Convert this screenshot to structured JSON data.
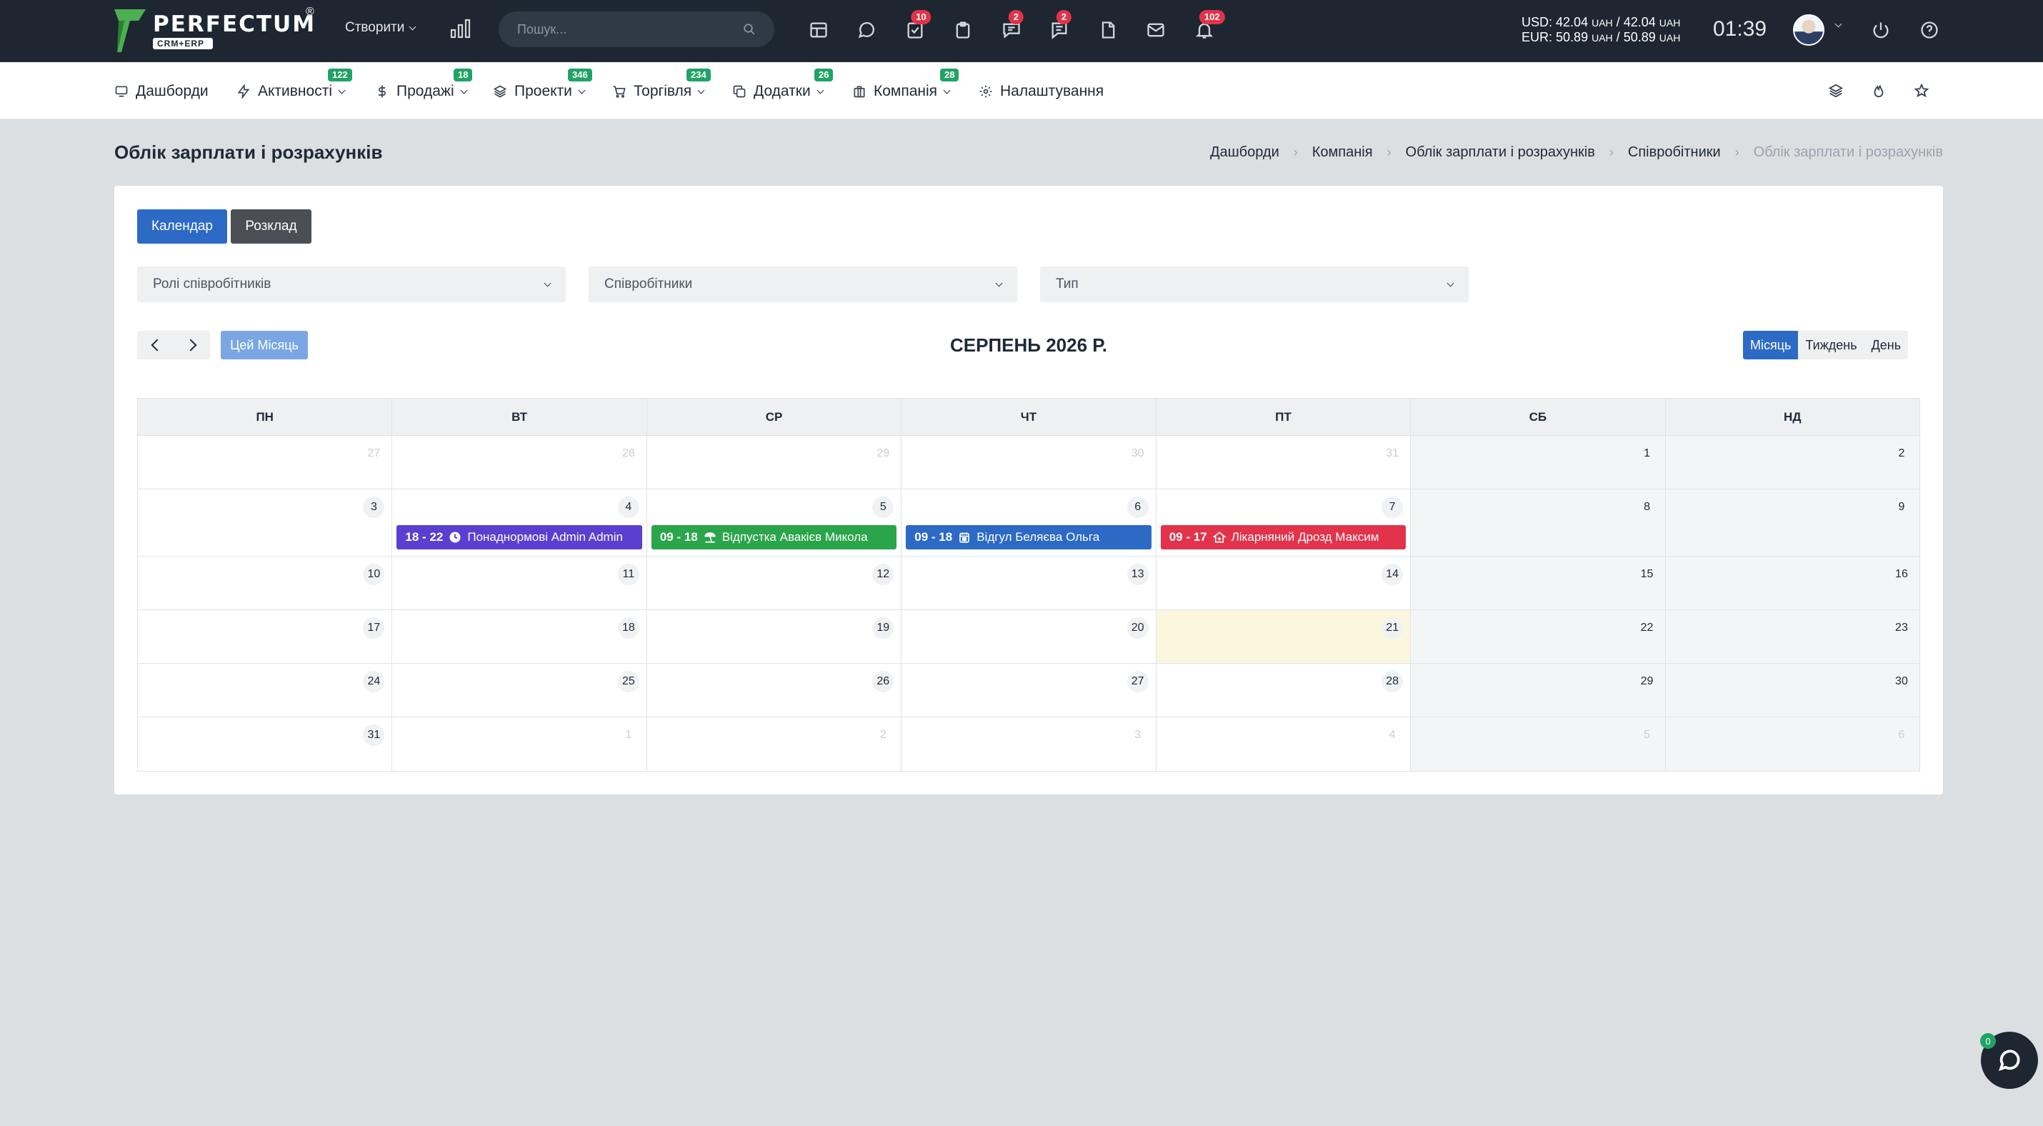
{
  "brand": {
    "name": "PERFECTUM",
    "sub": "CRM+ERP",
    "reg": "®"
  },
  "topbar": {
    "create_label": "Створити",
    "search_placeholder": "Пошук...",
    "icons": [
      {
        "name": "table-icon"
      },
      {
        "name": "chat-icon"
      },
      {
        "name": "tasks-icon",
        "badge": "10"
      },
      {
        "name": "clipboard-icon"
      },
      {
        "name": "messages-icon",
        "badge": "2"
      },
      {
        "name": "comments-icon",
        "badge": "2"
      },
      {
        "name": "document-icon"
      },
      {
        "name": "mail-icon"
      },
      {
        "name": "bell-icon",
        "badge": "102"
      }
    ],
    "rates": {
      "usd_label": "USD:",
      "usd_value": "42.04",
      "usd_cur1": "UAH",
      "usd_sep": "/",
      "usd_value2": "42.04",
      "usd_cur2": "UAH",
      "eur_label": "EUR:",
      "eur_value": "50.89",
      "eur_cur1": "UAH",
      "eur_sep": "/",
      "eur_value2": "50.89",
      "eur_cur2": "UAH"
    },
    "time": "01:39"
  },
  "nav": {
    "items": [
      {
        "label": "Дашборди",
        "icon": "monitor-icon"
      },
      {
        "label": "Активності",
        "badge": "122",
        "icon": "bolt-icon"
      },
      {
        "label": "Продажі",
        "badge": "18",
        "icon": "dollar-icon"
      },
      {
        "label": "Проекти",
        "badge": "346",
        "icon": "layers-icon"
      },
      {
        "label": "Торгівля",
        "badge": "234",
        "icon": "cart-icon"
      },
      {
        "label": "Додатки",
        "badge": "26",
        "icon": "copy-icon"
      },
      {
        "label": "Компанія",
        "badge": "28",
        "icon": "building-icon"
      },
      {
        "label": "Налаштування",
        "icon": "gear-icon"
      }
    ]
  },
  "page": {
    "title": "Облік зарплати і розрахунків",
    "breadcrumb": [
      "Дашборди",
      "Компанія",
      "Облік зарплати і розрахунків",
      "Співробітники",
      "Облік зарплати і розрахунків"
    ]
  },
  "toolbar": {
    "calendar_label": "Календар",
    "schedule_label": "Розклад",
    "filters": [
      "Ролі співробітників",
      "Співробітники",
      "Тип"
    ],
    "today_label": "Цей Місяць",
    "month_title": "СЕРПЕНЬ 2026 Р.",
    "views": [
      "Місяць",
      "Тиждень",
      "День"
    ],
    "active_view": "Місяць"
  },
  "calendar": {
    "weekdays": [
      "ПН",
      "ВТ",
      "СР",
      "ЧТ",
      "ПТ",
      "СБ",
      "НД"
    ],
    "weeks": [
      [
        "27",
        "28",
        "29",
        "30",
        "31",
        "1",
        "2"
      ],
      [
        "3",
        "4",
        "5",
        "6",
        "7",
        "8",
        "9"
      ],
      [
        "10",
        "11",
        "12",
        "13",
        "14",
        "15",
        "16"
      ],
      [
        "17",
        "18",
        "19",
        "20",
        "21",
        "22",
        "23"
      ],
      [
        "24",
        "25",
        "26",
        "27",
        "28",
        "29",
        "30"
      ],
      [
        "31",
        "1",
        "2",
        "3",
        "4",
        "5",
        "6"
      ]
    ],
    "today": "21",
    "events": [
      {
        "time": "18 - 22",
        "title": "Понаднормові Admin Admin",
        "color": "#5b3fd0",
        "icon": "clock-icon"
      },
      {
        "time": "09 - 18",
        "title": "Відпустка Авакієв Микола",
        "color": "#2aa54a",
        "icon": "beach-icon"
      },
      {
        "time": "09 - 18",
        "title": "Відгул Беляєва Ольга",
        "color": "#2c6ac6",
        "icon": "calendar-icon"
      },
      {
        "time": "09 - 17",
        "title": "Лікарняний Дрозд Максим",
        "color": "#e2334a",
        "icon": "house-medical-icon"
      }
    ]
  },
  "chat": {
    "badge": "0"
  }
}
